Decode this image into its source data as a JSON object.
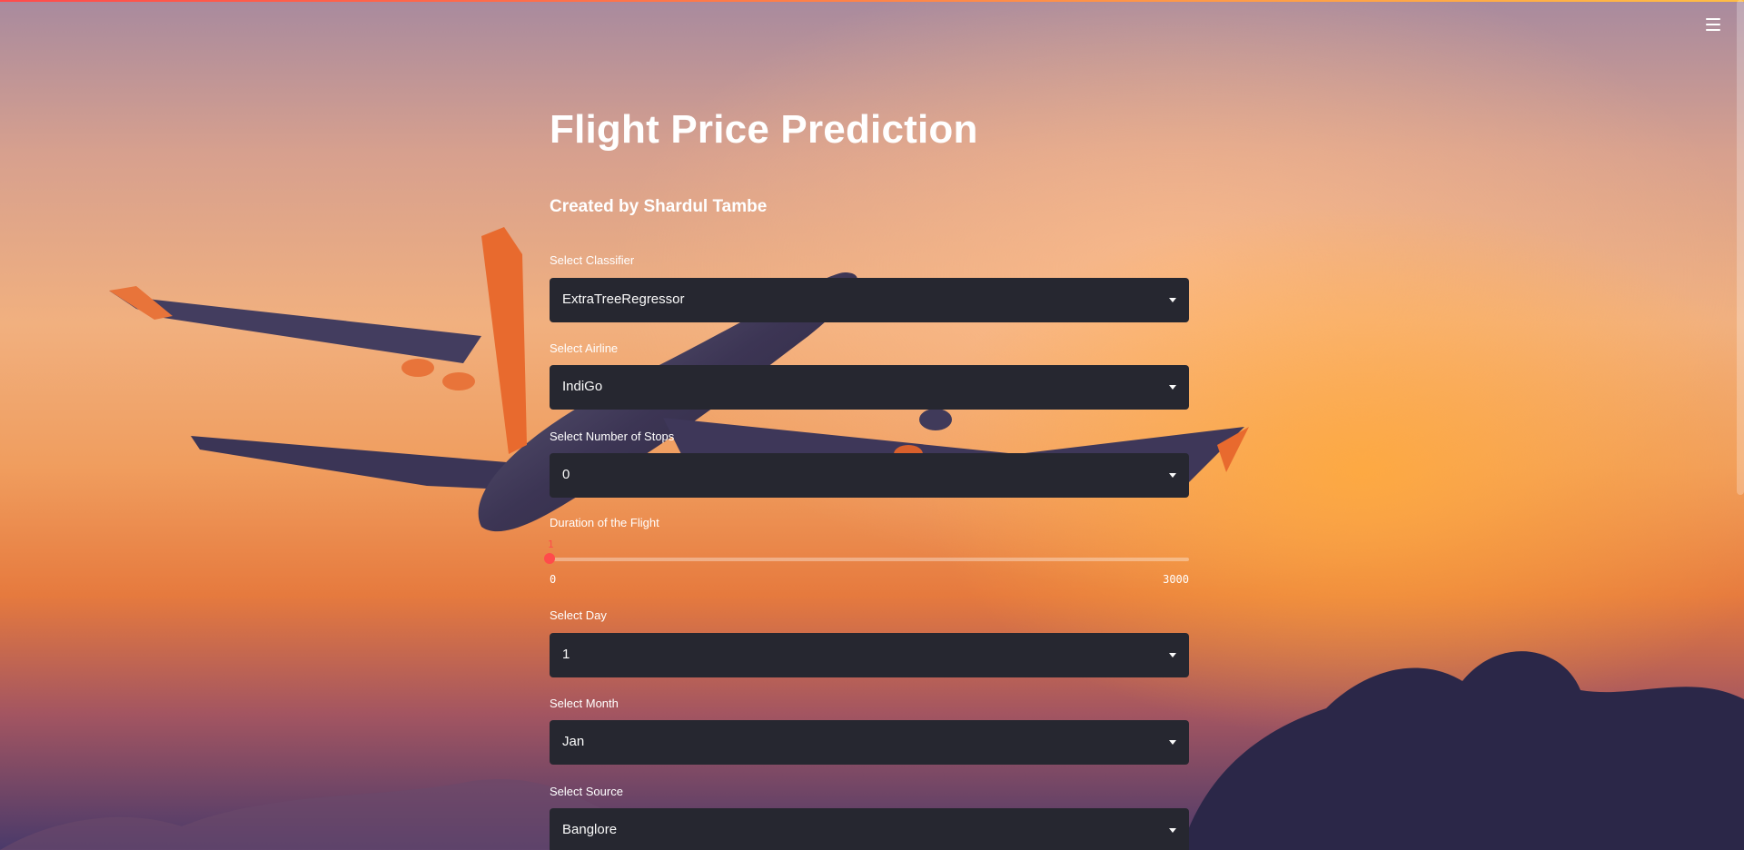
{
  "app": {
    "title": "Flight Price Prediction",
    "subtitle": "Created by Shardul Tambe"
  },
  "theme": {
    "accent": "#ff4b4b",
    "select_bg": "#262730",
    "text": "#ffffff"
  },
  "header": {
    "menu_icon": "hamburger-menu-icon"
  },
  "form": {
    "classifier": {
      "label": "Select Classifier",
      "value": "ExtraTreeRegressor"
    },
    "airline": {
      "label": "Select Airline",
      "value": "IndiGo"
    },
    "stops": {
      "label": "Select Number of Stops",
      "value": "0"
    },
    "duration": {
      "label": "Duration of the Flight",
      "value": "1",
      "min": "0",
      "max": "3000"
    },
    "day": {
      "label": "Select Day",
      "value": "1"
    },
    "month": {
      "label": "Select Month",
      "value": "Jan"
    },
    "source": {
      "label": "Select Source",
      "value": "Banglore"
    }
  }
}
